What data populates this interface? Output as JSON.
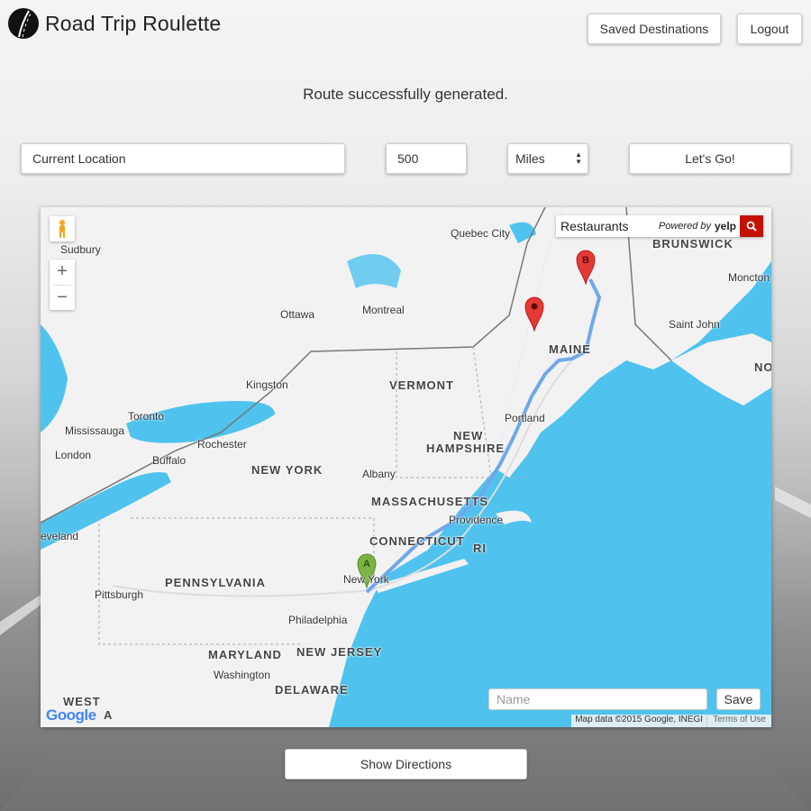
{
  "app": {
    "title": "Road Trip Roulette"
  },
  "header": {
    "saved_destinations": "Saved Destinations",
    "logout": "Logout"
  },
  "status_message": "Route successfully generated.",
  "form": {
    "location_value": "Current Location",
    "distance_value": "500",
    "unit_value": "Miles",
    "go_label": "Let's Go!"
  },
  "map": {
    "search": {
      "value": "Restaurants",
      "powered_by": "Powered by",
      "provider": "yelp"
    },
    "zoom_in": "+",
    "zoom_out": "−",
    "name_placeholder": "Name",
    "save_label": "Save",
    "attribution": "Map data ©2015 Google, INEGI",
    "terms": "Terms of Use",
    "google": "Google",
    "markers": {
      "start": "A",
      "end": "B"
    },
    "colors": {
      "water": "#4fc3ee",
      "land": "#f2f2f2",
      "route": "#6fa8e8",
      "marker_start": "#7cb342",
      "marker_end": "#e53935"
    },
    "places": [
      {
        "id": "sudbury",
        "name": "Sudbury"
      },
      {
        "id": "quebec",
        "name": "Quebec City"
      },
      {
        "id": "ottawa",
        "name": "Ottawa"
      },
      {
        "id": "montreal",
        "name": "Montreal"
      },
      {
        "id": "kingston",
        "name": "Kingston"
      },
      {
        "id": "toronto",
        "name": "Toronto"
      },
      {
        "id": "mississauga",
        "name": "Mississauga"
      },
      {
        "id": "rochester",
        "name": "Rochester"
      },
      {
        "id": "london",
        "name": "London"
      },
      {
        "id": "buffalo",
        "name": "Buffalo"
      },
      {
        "id": "albany",
        "name": "Albany"
      },
      {
        "id": "portland",
        "name": "Portland"
      },
      {
        "id": "providence",
        "name": "Providence"
      },
      {
        "id": "cleveland",
        "name": "eveland"
      },
      {
        "id": "pittsburgh",
        "name": "Pittsburgh"
      },
      {
        "id": "newyork",
        "name": "New York"
      },
      {
        "id": "philadelphia",
        "name": "Philadelphia"
      },
      {
        "id": "washington",
        "name": "Washington"
      },
      {
        "id": "moncton",
        "name": "Moncton"
      },
      {
        "id": "saintjohn",
        "name": "Saint John"
      }
    ],
    "regions": [
      {
        "id": "brunswick",
        "name": "BRUNSWICK"
      },
      {
        "id": "maine",
        "name": "MAINE"
      },
      {
        "id": "vermont",
        "name": "VERMONT"
      },
      {
        "id": "newhampshire1",
        "name": "NEW"
      },
      {
        "id": "newhampshire2",
        "name": "HAMPSHIRE"
      },
      {
        "id": "newyorkstate",
        "name": "NEW YORK"
      },
      {
        "id": "massachusetts",
        "name": "MASSACHUSETTS"
      },
      {
        "id": "connecticut",
        "name": "CONNECTICUT"
      },
      {
        "id": "ri",
        "name": "RI"
      },
      {
        "id": "pennsylvania",
        "name": "PENNSYLVANIA"
      },
      {
        "id": "maryland",
        "name": "MARYLAND"
      },
      {
        "id": "newjersey",
        "name": "NEW JERSEY"
      },
      {
        "id": "delaware",
        "name": "DELAWARE"
      },
      {
        "id": "westva1",
        "name": "WEST"
      },
      {
        "id": "westva2",
        "name": "A"
      },
      {
        "id": "novascotia",
        "name": "NO"
      }
    ]
  },
  "footer": {
    "show_directions": "Show Directions"
  }
}
